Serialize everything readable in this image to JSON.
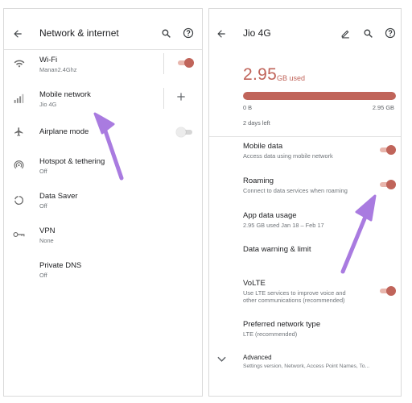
{
  "left": {
    "title": "Network & internet",
    "items": [
      {
        "label": "Wi-Fi",
        "sub": "Manan2.4Ghz",
        "icon": "wifi-icon"
      },
      {
        "label": "Mobile network",
        "sub": "Jio 4G",
        "icon": "signal-icon"
      },
      {
        "label": "Airplane mode",
        "sub": "",
        "icon": "airplane-icon"
      },
      {
        "label": "Hotspot & tethering",
        "sub": "Off",
        "icon": "hotspot-icon"
      },
      {
        "label": "Data Saver",
        "sub": "Off",
        "icon": "data-saver-icon"
      },
      {
        "label": "VPN",
        "sub": "None",
        "icon": "vpn-key-icon"
      },
      {
        "label": "Private DNS",
        "sub": "Off",
        "icon": ""
      }
    ],
    "wifi_on": true,
    "airplane_on": false
  },
  "right": {
    "title": "Jio 4G",
    "usage_value": "2.95",
    "usage_unit": "GB used",
    "usage_fraction": 1.0,
    "bar_min": "0 B",
    "bar_max": "2.95 GB",
    "days_left": "2 days left",
    "items": [
      {
        "label": "Mobile data",
        "sub": "Access data using mobile network"
      },
      {
        "label": "Roaming",
        "sub": "Connect to data services when roaming"
      },
      {
        "label": "App data usage",
        "sub": "2.95 GB used Jan 18 – Feb 17"
      },
      {
        "label": "Data warning & limit",
        "sub": ""
      },
      {
        "label": "VoLTE",
        "sub1": "Use LTE services to improve voice and",
        "sub2": "other communications (recommended)"
      },
      {
        "label": "Preferred network type",
        "sub": "LTE (recommended)"
      },
      {
        "label": "Advanced",
        "sub": "Settings version, Network, Access Point Names, To..."
      }
    ],
    "mobile_data_on": true,
    "roaming_on": true,
    "volte_on": true
  },
  "colors": {
    "accent": "#c0645a",
    "annotation_arrow": "#a97be0"
  }
}
